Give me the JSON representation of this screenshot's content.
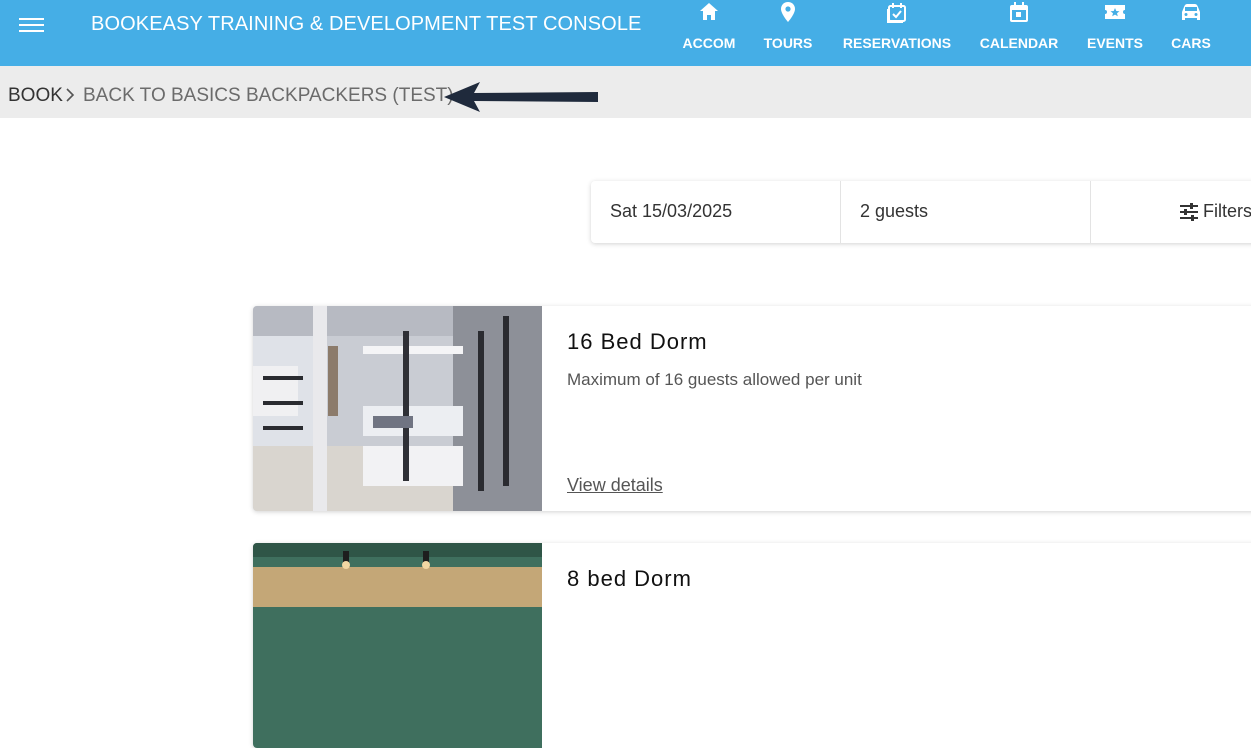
{
  "header": {
    "title": "BOOKEASY TRAINING & DEVELOPMENT TEST CONSOLE",
    "menu_icon": "hamburger-menu-icon",
    "nav": [
      {
        "label": "ACCOM",
        "icon": "home-icon"
      },
      {
        "label": "TOURS",
        "icon": "map-pin-icon"
      },
      {
        "label": "RESERVATIONS",
        "icon": "calendar-check-icon"
      },
      {
        "label": "CALENDAR",
        "icon": "calendar-icon"
      },
      {
        "label": "EVENTS",
        "icon": "ticket-star-icon"
      },
      {
        "label": "CARS",
        "icon": "car-icon"
      }
    ],
    "accent_color": "#45aee6"
  },
  "breadcrumb": {
    "root": "BOOK",
    "current": "BACK TO BASICS BACKPACKERS (TEST)"
  },
  "search": {
    "date": "Sat 15/03/2025",
    "guests": "2 guests",
    "filters_label": "Filters"
  },
  "rooms": [
    {
      "title": "16 Bed Dorm",
      "description": "Maximum of 16 guests allowed per unit",
      "link": "View details"
    },
    {
      "title": "8 bed Dorm"
    }
  ]
}
